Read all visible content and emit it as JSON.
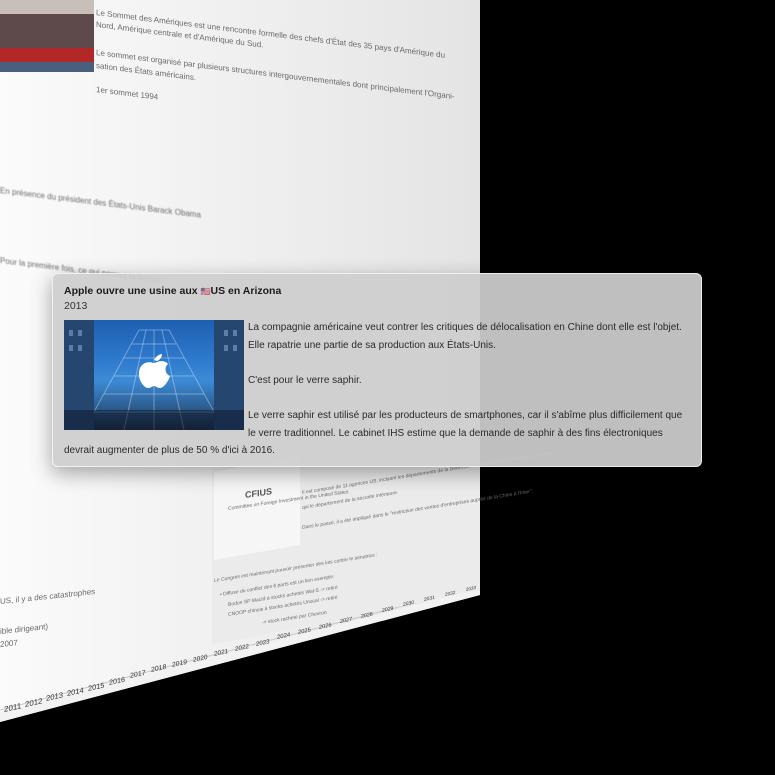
{
  "popup": {
    "title_prefix": "Apple ouvre une usine aux ",
    "flag": "🇺🇸",
    "title_suffix": "US en Arizona",
    "year": "2013",
    "paragraphs": [
      "La compagnie américaine veut contrer les critiques de délocalisation en Chine dont elle est l'objet. Elle rapatrie une partie de sa production aux États-Unis.",
      "C'est pour le verre saphir.",
      "Le verre saphir est utilisé par les producteurs de smartphones, car il s'abîme plus difficilement que le verre traditionnel. Le cabinet IHS estime que la demande de saphir à des fins électroniques devrait augmenter de plus de 50 % d'ici à 2016."
    ],
    "image_logo": ""
  },
  "background": {
    "lines_top": [
      "Le Sommet des Amériques est une rencontre formelle des chefs d'État des 35 pays d'Amérique du",
      "Nord, Amérique centrale et d'Amérique du Sud.",
      "Le sommet est organisé par plusieurs structures intergouvernementales dont principalement l'Organi-",
      "sation des États américains.",
      "1er sommet 1994"
    ],
    "line_obama": "En présence du président des États-Unis Barack Obama",
    "line_first": "Pour la première fois, ce qui permet la lecture...",
    "cfius_title": "CFIUS",
    "cfius_sub": "Committee on Foreign Investment in the United States",
    "cfius_lines": [
      "Il est composé de 11 agences US, incluant les départements de la Défense, du Trésor et du Commerce. Il analyse",
      "qui le département de la sécurité intérieure.",
      "Dans le passé, il a été impliqué dans le \"restriction des ventes d'entreprises auprès de la Chine à l'Inter\"."
    ],
    "congress_line": "Le Congrès est maintenant pouvoir présenter des lois contre le sénatrice :",
    "bullets": [
      "• Diffuse du conflict des 6 parts est un lien exemple:",
      "Bodon SP MacId à stocks achetés Wal-S -> retiré",
      "CNOOP chinois à stocks achetés Unocal -> retiré",
      "-> stock racheté par Chevron"
    ],
    "left_frag1": "US, il y a des catastrophes",
    "left_frag2": "ible dirigeant)",
    "left_frag3": "2007",
    "years": [
      "2011",
      "2012",
      "2013",
      "2014",
      "2015",
      "2016",
      "2017",
      "2018",
      "2019",
      "2020",
      "2021",
      "2022",
      "2023",
      "2024",
      "2025",
      "2026",
      "2027",
      "2028",
      "2029",
      "2030",
      "2031",
      "2032",
      "2033"
    ]
  }
}
